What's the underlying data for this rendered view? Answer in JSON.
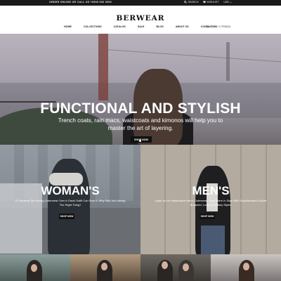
{
  "topbar": {
    "promo": "ORDER ONLINE OR CALL US +0000 000 0000",
    "search_label": "SEARCH",
    "wishlist_label": "WISHLIST",
    "currency": "USD"
  },
  "header": {
    "logo": "BERWEAR",
    "nav": [
      "HOME",
      "COLLECTIONS",
      "CATALOG",
      "SALE",
      "BLOG",
      "ABOUT US",
      "CONTACT US"
    ],
    "cart_label": "CART / 0 ITEM(S)"
  },
  "hero": {
    "title": "FUNCTIONAL AND STYLISH",
    "subtitle": "Trench coats, rain macs, waistcoats and kimonos will help you to master the art of layering.",
    "button": "SHOP NOW"
  },
  "categories": [
    {
      "title": "WOMAN'S",
      "description": "If Choosing The Wrong Outerwear Over A Great Outfit Can Ruin It, Why Risk Not Having The Right Thing?",
      "button": "SHOP NOW"
    },
    {
      "title": "MEN'S",
      "description": "Layer Up In Fashionable Men's Outerwear. Stay Warm In Style With Sophisticated Double Breasted, Long Or Military Styles",
      "button": "SHOP NOW"
    }
  ]
}
